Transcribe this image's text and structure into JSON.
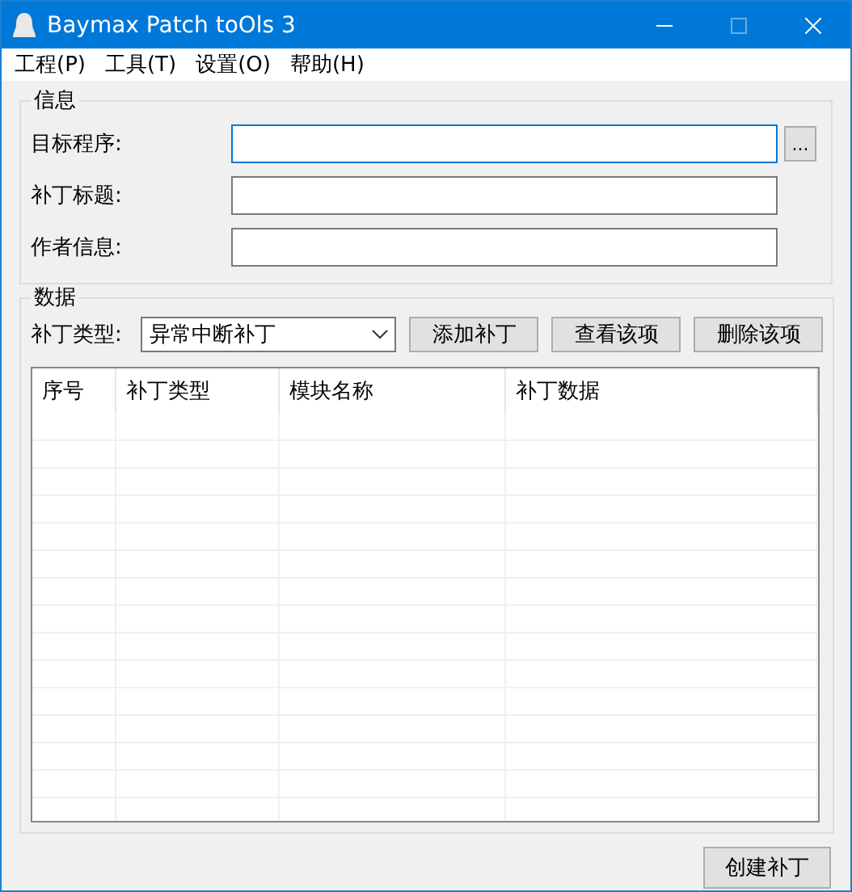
{
  "window": {
    "title": "Baymax Patch toOls 3",
    "maximize_disabled": true
  },
  "menu": [
    "工程(P)",
    "工具(T)",
    "设置(O)",
    "帮助(H)"
  ],
  "info_group": {
    "title": "信息",
    "fields": [
      {
        "label": "目标程序:",
        "focused": true,
        "browse": "..."
      },
      {
        "label": "补丁标题:",
        "focused": false
      },
      {
        "label": "作者信息:",
        "focused": false
      }
    ]
  },
  "data_group": {
    "title": "数据",
    "type_label": "补丁类型:",
    "type_value": "异常中断补丁",
    "buttons": [
      "添加补丁",
      "查看该项",
      "删除该项"
    ],
    "table": {
      "columns": [
        "序号",
        "补丁类型",
        "模块名称",
        "补丁数据"
      ]
    }
  },
  "create_button": "创建补丁"
}
